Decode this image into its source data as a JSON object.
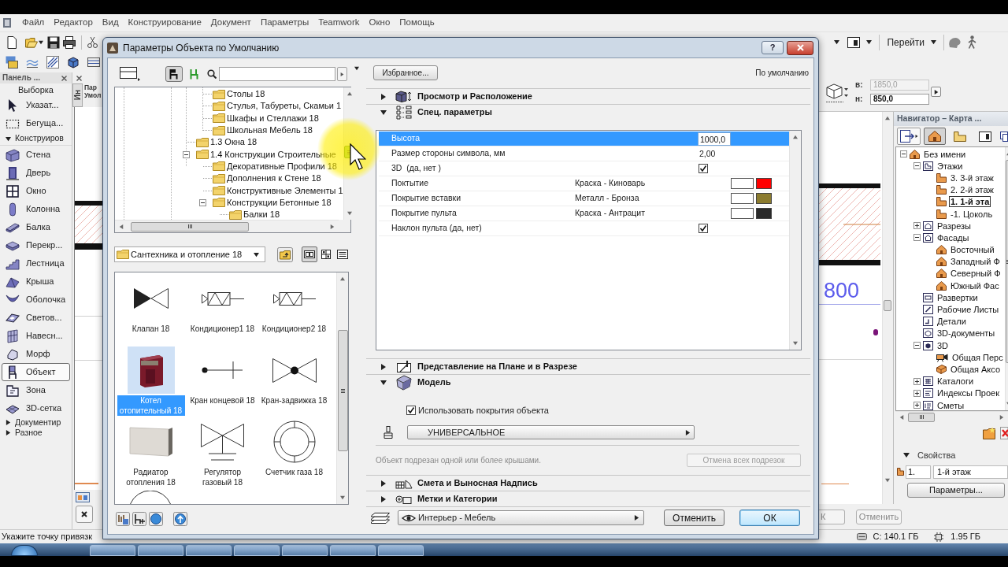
{
  "menu_bar": {
    "items": [
      "Файл",
      "Редактор",
      "Вид",
      "Конструирование",
      "Документ",
      "Параметры",
      "Teamwork",
      "Окно",
      "Помощь"
    ]
  },
  "toolbar": {
    "goto_button": "Перейти"
  },
  "info_box": {
    "fields": [
      {
        "label": "в:",
        "value": "1850,0",
        "disabled": true
      },
      {
        "label": "н:",
        "value": "850,0",
        "disabled": false
      }
    ]
  },
  "toolbox": {
    "title": "Панель ...",
    "section": "Выборка",
    "tools": [
      {
        "label": "Указат...",
        "selected": false
      },
      {
        "label": "Бегуща...",
        "selected": false
      }
    ],
    "groups": [
      {
        "label": "Конструиров",
        "expanded": true,
        "tools": [
          {
            "label": "Стена",
            "selected": false
          },
          {
            "label": "Дверь",
            "selected": false
          },
          {
            "label": "Окно",
            "selected": false
          },
          {
            "label": "Колонна",
            "selected": false
          },
          {
            "label": "Балка",
            "selected": false
          },
          {
            "label": "Перекр...",
            "selected": false
          },
          {
            "label": "Лестница",
            "selected": false
          },
          {
            "label": "Крыша",
            "selected": false
          },
          {
            "label": "Оболочка",
            "selected": false
          },
          {
            "label": "Светов...",
            "selected": false
          },
          {
            "label": "Навесн...",
            "selected": false
          },
          {
            "label": "Морф",
            "selected": false
          },
          {
            "label": "Объект",
            "selected": true
          },
          {
            "label": "Зона",
            "selected": false
          },
          {
            "label": "3D-сетка",
            "selected": false
          }
        ]
      },
      {
        "label": "Документир",
        "expanded": false
      },
      {
        "label": "Разное",
        "expanded": false
      }
    ]
  },
  "side_palette": {
    "tab": "Ин",
    "title_lines": [
      "Пар",
      "Умол"
    ]
  },
  "canvas": {
    "dimension": "800"
  },
  "navigator": {
    "title": "Навигатор – Карта ...",
    "view_modes": [
      {
        "selected": true
      },
      {
        "selected": false
      },
      {
        "selected": false
      },
      {
        "selected": false
      }
    ],
    "tree": [
      {
        "label": "Без имени",
        "kind": "project",
        "expanded": true,
        "children": [
          {
            "label": "Этажи",
            "kind": "stories",
            "expanded": true,
            "children": [
              {
                "label": "3. 3-й этаж",
                "kind": "story",
                "selected": false
              },
              {
                "label": "2. 2-й этаж",
                "kind": "story",
                "selected": false
              },
              {
                "label": "1. 1-й эта",
                "kind": "story",
                "selected": true
              },
              {
                "label": "-1. Цоколь",
                "kind": "story",
                "selected": false
              }
            ]
          },
          {
            "label": "Разрезы",
            "kind": "sections",
            "expanded": false
          },
          {
            "label": "Фасады",
            "kind": "elevations",
            "expanded": true,
            "children": [
              {
                "label": "Восточный",
                "kind": "elevation"
              },
              {
                "label": "Западный Ф",
                "kind": "elevation"
              },
              {
                "label": "Северный Ф",
                "kind": "elevation"
              },
              {
                "label": "Южный Фас",
                "kind": "elevation"
              }
            ]
          },
          {
            "label": "Развертки",
            "kind": "interior"
          },
          {
            "label": "Рабочие Листы",
            "kind": "worksheet"
          },
          {
            "label": "Детали",
            "kind": "detail"
          },
          {
            "label": "3D-документы",
            "kind": "document"
          },
          {
            "label": "3D",
            "kind": "view3d",
            "expanded": true,
            "children": [
              {
                "label": "Общая Перс",
                "kind": "camera"
              },
              {
                "label": "Общая Аксо",
                "kind": "axonometry"
              }
            ]
          },
          {
            "label": "Каталоги",
            "kind": "schedule",
            "expanded": false
          },
          {
            "label": "Индексы Проек",
            "kind": "index",
            "expanded": false
          },
          {
            "label": "Сметы",
            "kind": "list",
            "expanded": false
          }
        ]
      }
    ],
    "properties": {
      "title": "Свойства",
      "expanded": true,
      "number": "1.",
      "name": "1-й этаж"
    },
    "settings_button": "Параметры..."
  },
  "canvas_buttons": [
    "К",
    "Отменить"
  ],
  "status_bar": {
    "hint": "Укажите точку привязк",
    "disk": "C: 140.1 ГБ",
    "memory": "1.95 ГБ"
  },
  "dialog": {
    "title": "Параметры Объекта по Умолчанию",
    "help_button": "?",
    "library": {
      "mode_buttons": [
        {
          "selected": true
        },
        {
          "selected": false
        }
      ],
      "tree": [
        {
          "children": [
            {
              "label": "Столы 18"
            },
            {
              "label": "Стулья, Табуреты, Скамьи 1"
            },
            {
              "label": "Шкафы и Стеллажи 18"
            },
            {
              "label": "Школьная Мебель 18"
            }
          ]
        },
        {
          "label": "1.3 Окна 18"
        },
        {
          "label": "1.4 Конструкции Строительные",
          "expanded": true,
          "children": [
            {
              "label": "Декоративные Профили 18"
            },
            {
              "label": "Дополнения к Стене 18"
            },
            {
              "label": "Конструктивные Элементы 1"
            },
            {
              "label": "Конструкции Бетонные 18",
              "expanded": true,
              "children": [
                {
                  "label": "Балки 18"
                }
              ]
            }
          ]
        }
      ],
      "folder": "Сантехника и отопление 18",
      "view_modes": [
        {
          "selected": true
        },
        {
          "selected": false
        },
        {
          "selected": false
        }
      ],
      "items": [
        {
          "label": "Клапан 18",
          "selected": false
        },
        {
          "label": "Кондиционер1 18",
          "selected": false
        },
        {
          "label": "Кондиционер2 18",
          "selected": false
        },
        {
          "label": "Котел отопительный 18",
          "selected": true
        },
        {
          "label": "Кран концевой 18",
          "selected": false
        },
        {
          "label": "Кран-задвижка 18",
          "selected": false
        },
        {
          "label": "Радиатор отопления 18",
          "selected": false
        },
        {
          "label": "Регулятор газовый 18",
          "selected": false
        },
        {
          "label": "Счетчик газа 18",
          "selected": false
        }
      ]
    },
    "favorites_button": "Избранное...",
    "preset_label": "По умолчанию",
    "sections": [
      {
        "title": "Просмотр и Расположение",
        "kind": "preview",
        "expanded": false
      },
      {
        "title": "Спец. параметры",
        "kind": "parameters",
        "expanded": true,
        "params": [
          {
            "kind": "value",
            "name": "Высота",
            "value": "1000,0",
            "selected": true
          },
          {
            "kind": "value",
            "name": "Размер стороны символа, мм",
            "value": "2,00",
            "selected": false
          },
          {
            "kind": "check",
            "name": "3D  (да, нет )",
            "checked": true,
            "selected": false
          },
          {
            "kind": "material",
            "name": "Поктытие",
            "value": "Краска - Киноварь",
            "color": "#ff0000",
            "selected": false
          },
          {
            "kind": "material",
            "name": "Покрытие вставки",
            "value": "Металл - Бронза",
            "color": "#8b7b2e",
            "selected": false
          },
          {
            "kind": "material",
            "name": "Покрытие пульта",
            "value": "Краска - Антрацит",
            "color": "#2a2a2a",
            "selected": false
          },
          {
            "kind": "check",
            "name": "Наклон пульта (да, нет)",
            "checked": true,
            "selected": false
          }
        ]
      },
      {
        "title": "Представление на Плане и в Разрезе",
        "kind": "floorplan",
        "expanded": false
      },
      {
        "title": "Модель",
        "kind": "model",
        "expanded": true,
        "use_object_materials": {
          "label": "Использовать покрытия объекта",
          "checked": true
        },
        "surface": "УНИВЕРСАЛЬНОЕ",
        "note": "Объект подрезан одной или более крышами.",
        "cancel_trims": {
          "label": "Отмена всех подрезок",
          "disabled": true
        }
      },
      {
        "title": "Смета и Выносная Надпись",
        "kind": "listing",
        "expanded": false
      },
      {
        "title": "Метки и Категории",
        "kind": "categories",
        "expanded": false
      }
    ],
    "layer": "Интерьер - Мебель",
    "buttons": [
      {
        "label": "Отменить",
        "default": false
      },
      {
        "label": "ОК",
        "default": true
      }
    ]
  }
}
